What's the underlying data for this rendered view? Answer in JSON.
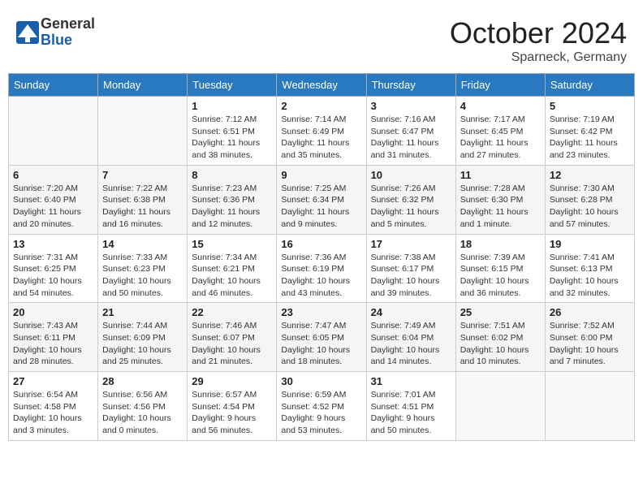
{
  "header": {
    "logo": {
      "general": "General",
      "blue": "Blue"
    },
    "title": "October 2024",
    "location": "Sparneck, Germany"
  },
  "weekdays": [
    "Sunday",
    "Monday",
    "Tuesday",
    "Wednesday",
    "Thursday",
    "Friday",
    "Saturday"
  ],
  "weeks": [
    [
      {
        "day": null,
        "info": null
      },
      {
        "day": null,
        "info": null
      },
      {
        "day": "1",
        "info": "Sunrise: 7:12 AM\nSunset: 6:51 PM\nDaylight: 11 hours and 38 minutes."
      },
      {
        "day": "2",
        "info": "Sunrise: 7:14 AM\nSunset: 6:49 PM\nDaylight: 11 hours and 35 minutes."
      },
      {
        "day": "3",
        "info": "Sunrise: 7:16 AM\nSunset: 6:47 PM\nDaylight: 11 hours and 31 minutes."
      },
      {
        "day": "4",
        "info": "Sunrise: 7:17 AM\nSunset: 6:45 PM\nDaylight: 11 hours and 27 minutes."
      },
      {
        "day": "5",
        "info": "Sunrise: 7:19 AM\nSunset: 6:42 PM\nDaylight: 11 hours and 23 minutes."
      }
    ],
    [
      {
        "day": "6",
        "info": "Sunrise: 7:20 AM\nSunset: 6:40 PM\nDaylight: 11 hours and 20 minutes."
      },
      {
        "day": "7",
        "info": "Sunrise: 7:22 AM\nSunset: 6:38 PM\nDaylight: 11 hours and 16 minutes."
      },
      {
        "day": "8",
        "info": "Sunrise: 7:23 AM\nSunset: 6:36 PM\nDaylight: 11 hours and 12 minutes."
      },
      {
        "day": "9",
        "info": "Sunrise: 7:25 AM\nSunset: 6:34 PM\nDaylight: 11 hours and 9 minutes."
      },
      {
        "day": "10",
        "info": "Sunrise: 7:26 AM\nSunset: 6:32 PM\nDaylight: 11 hours and 5 minutes."
      },
      {
        "day": "11",
        "info": "Sunrise: 7:28 AM\nSunset: 6:30 PM\nDaylight: 11 hours and 1 minute."
      },
      {
        "day": "12",
        "info": "Sunrise: 7:30 AM\nSunset: 6:28 PM\nDaylight: 10 hours and 57 minutes."
      }
    ],
    [
      {
        "day": "13",
        "info": "Sunrise: 7:31 AM\nSunset: 6:25 PM\nDaylight: 10 hours and 54 minutes."
      },
      {
        "day": "14",
        "info": "Sunrise: 7:33 AM\nSunset: 6:23 PM\nDaylight: 10 hours and 50 minutes."
      },
      {
        "day": "15",
        "info": "Sunrise: 7:34 AM\nSunset: 6:21 PM\nDaylight: 10 hours and 46 minutes."
      },
      {
        "day": "16",
        "info": "Sunrise: 7:36 AM\nSunset: 6:19 PM\nDaylight: 10 hours and 43 minutes."
      },
      {
        "day": "17",
        "info": "Sunrise: 7:38 AM\nSunset: 6:17 PM\nDaylight: 10 hours and 39 minutes."
      },
      {
        "day": "18",
        "info": "Sunrise: 7:39 AM\nSunset: 6:15 PM\nDaylight: 10 hours and 36 minutes."
      },
      {
        "day": "19",
        "info": "Sunrise: 7:41 AM\nSunset: 6:13 PM\nDaylight: 10 hours and 32 minutes."
      }
    ],
    [
      {
        "day": "20",
        "info": "Sunrise: 7:43 AM\nSunset: 6:11 PM\nDaylight: 10 hours and 28 minutes."
      },
      {
        "day": "21",
        "info": "Sunrise: 7:44 AM\nSunset: 6:09 PM\nDaylight: 10 hours and 25 minutes."
      },
      {
        "day": "22",
        "info": "Sunrise: 7:46 AM\nSunset: 6:07 PM\nDaylight: 10 hours and 21 minutes."
      },
      {
        "day": "23",
        "info": "Sunrise: 7:47 AM\nSunset: 6:05 PM\nDaylight: 10 hours and 18 minutes."
      },
      {
        "day": "24",
        "info": "Sunrise: 7:49 AM\nSunset: 6:04 PM\nDaylight: 10 hours and 14 minutes."
      },
      {
        "day": "25",
        "info": "Sunrise: 7:51 AM\nSunset: 6:02 PM\nDaylight: 10 hours and 10 minutes."
      },
      {
        "day": "26",
        "info": "Sunrise: 7:52 AM\nSunset: 6:00 PM\nDaylight: 10 hours and 7 minutes."
      }
    ],
    [
      {
        "day": "27",
        "info": "Sunrise: 6:54 AM\nSunset: 4:58 PM\nDaylight: 10 hours and 3 minutes."
      },
      {
        "day": "28",
        "info": "Sunrise: 6:56 AM\nSunset: 4:56 PM\nDaylight: 10 hours and 0 minutes."
      },
      {
        "day": "29",
        "info": "Sunrise: 6:57 AM\nSunset: 4:54 PM\nDaylight: 9 hours and 56 minutes."
      },
      {
        "day": "30",
        "info": "Sunrise: 6:59 AM\nSunset: 4:52 PM\nDaylight: 9 hours and 53 minutes."
      },
      {
        "day": "31",
        "info": "Sunrise: 7:01 AM\nSunset: 4:51 PM\nDaylight: 9 hours and 50 minutes."
      },
      {
        "day": null,
        "info": null
      },
      {
        "day": null,
        "info": null
      }
    ]
  ]
}
